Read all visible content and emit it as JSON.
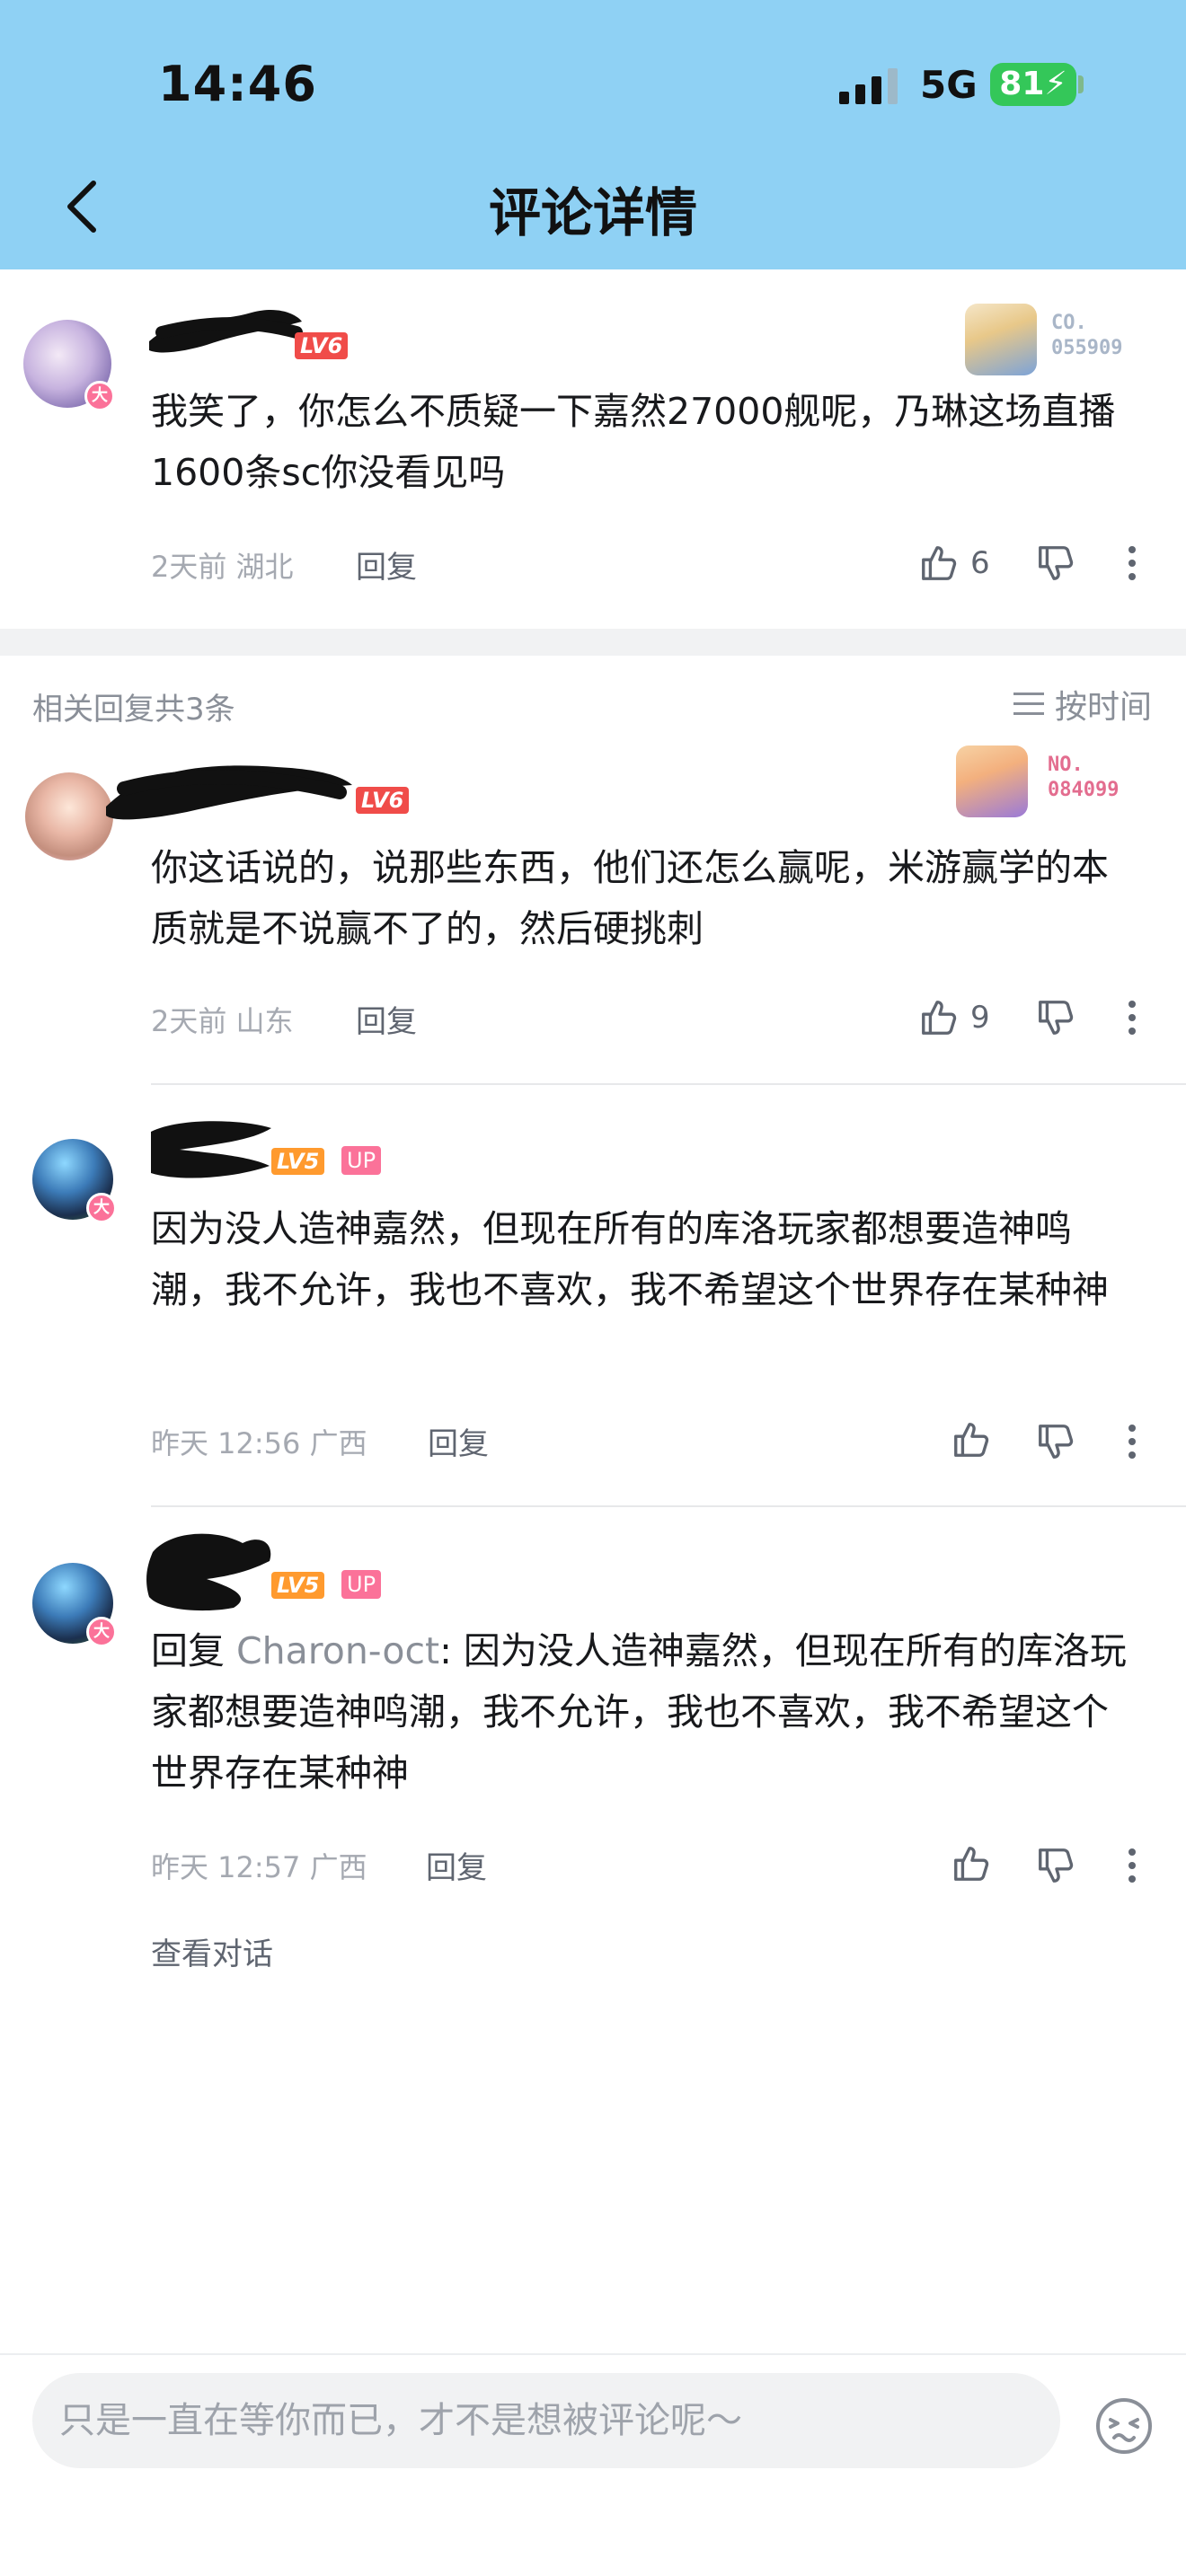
{
  "status_bar": {
    "time": "14:46",
    "network": "5G",
    "battery": "81"
  },
  "header": {
    "title": "评论详情"
  },
  "main_comment": {
    "level": "LV6",
    "fan_no_label": "CO.",
    "fan_no": "055909",
    "text": "我笑了，你怎么不质疑一下嘉然27000舰呢，乃琳这场直播1600条sc你没看见吗",
    "time": "2天前",
    "location": "湖北",
    "reply_label": "回复",
    "likes": "6"
  },
  "replies_header": {
    "count_text": "相关回复共3条",
    "sort_label": "按时间"
  },
  "replies": [
    {
      "level": "LV6",
      "fan_no_label": "NO.",
      "fan_no": "084099",
      "text": "你这话说的，说那些东西，他们还怎么赢呢，米游赢学的本质就是不说赢不了的，然后硬挑刺",
      "time": "2天前",
      "location": "山东",
      "reply_label": "回复",
      "likes": "9"
    },
    {
      "level": "LV5",
      "up_tag": "UP",
      "text": "因为没人造神嘉然，但现在所有的库洛玩家都想要造神鸣潮，我不允许，我也不喜欢，我不希望这个世界存在某种神",
      "time": "昨天 12:56",
      "location": "广西",
      "reply_label": "回复"
    },
    {
      "level": "LV5",
      "up_tag": "UP",
      "reply_prefix": "回复 ",
      "reply_to": "Charon-oct",
      "text": ": 因为没人造神嘉然，但现在所有的库洛玩家都想要造神鸣潮，我不允许，我也不喜欢，我不希望这个世界存在某种神",
      "time": "昨天 12:57",
      "location": "广西",
      "reply_label": "回复"
    }
  ],
  "view_conversation": "查看对话",
  "bottom_bar": {
    "placeholder": "只是一直在等你而已，才不是想被评论呢～"
  },
  "colors": {
    "header_bg": "#8fd1f4",
    "level6": "#f04c49",
    "level5": "#ff9a2e",
    "up_tag": "#fb7299",
    "battery": "#34c759"
  },
  "badges": {
    "big_member": "大"
  }
}
